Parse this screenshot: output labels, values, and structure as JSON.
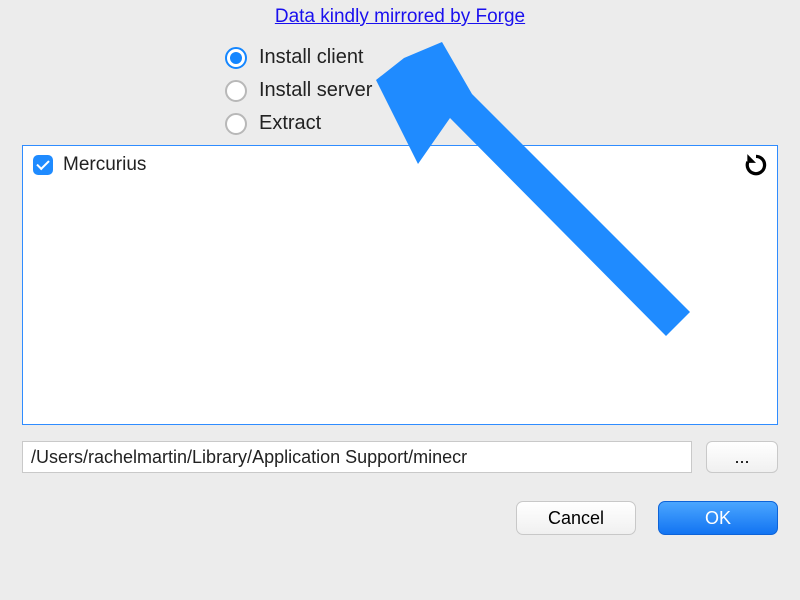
{
  "header": {
    "link_text": "Data kindly mirrored by Forge"
  },
  "radios": {
    "install_client": "Install client",
    "install_server": "Install server",
    "extract": "Extract",
    "selected": "install_client"
  },
  "list": {
    "items": [
      {
        "label": "Mercurius",
        "checked": true
      }
    ]
  },
  "path": {
    "value": "/Users/rachelmartin/Library/Application Support/minecr",
    "browse_label": "..."
  },
  "buttons": {
    "cancel": "Cancel",
    "ok": "OK"
  },
  "colors": {
    "accent": "#1f8bff",
    "link": "#1a10ee",
    "arrow": "#1f8bff"
  }
}
